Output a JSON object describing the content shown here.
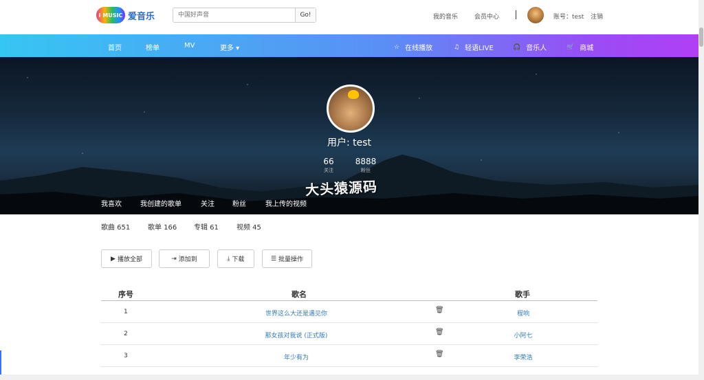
{
  "header": {
    "logo_badge": "i MUSIC",
    "logo_text": "爱音乐",
    "search_placeholder": "中国好声音",
    "search_button": "Go!",
    "link_my_music": "我的音乐",
    "link_member": "会员中心",
    "account_label": "账号：test",
    "logout": "注销"
  },
  "nav": {
    "left": [
      "首页",
      "榜单",
      "MV",
      "更多 ▾"
    ],
    "right": [
      {
        "icon": "star-icon",
        "glyph": "☆",
        "label": "在线播放"
      },
      {
        "icon": "music-note-icon",
        "glyph": "♫",
        "label": "轻语LIVE"
      },
      {
        "icon": "headphones-icon",
        "glyph": "🎧",
        "label": "音乐人"
      },
      {
        "icon": "cart-icon",
        "glyph": "🛒",
        "label": "商城"
      }
    ],
    "gradient": [
      "#36c6f3",
      "#b13ff5"
    ]
  },
  "profile": {
    "name": "用户: test",
    "follow_count": "66",
    "follow_label": "关注",
    "fans_count": "8888",
    "fans_label": "粉丝",
    "watermark": "大头猿源码",
    "tabs": [
      "我喜欢",
      "我创建的歌单",
      "关注",
      "粉丝",
      "我上传的视频"
    ]
  },
  "counts": [
    "歌曲 651",
    "歌单 166",
    "专辑 61",
    "视频 45"
  ],
  "actions": {
    "play_all": "播放全部",
    "add_to": "添加到",
    "download": "下载",
    "batch": "批量操作"
  },
  "table": {
    "headers": {
      "index": "序号",
      "song": "歌名",
      "singer": "歌手"
    },
    "rows": [
      {
        "index": "1",
        "song": "世界这么大还是遇见你",
        "singer": "程响"
      },
      {
        "index": "2",
        "song": "那女孩对我说 (正式版)",
        "singer": "小阿七"
      },
      {
        "index": "3",
        "song": "年少有为",
        "singer": "李荣浩"
      }
    ]
  },
  "colors": {
    "link": "#337ab7"
  }
}
